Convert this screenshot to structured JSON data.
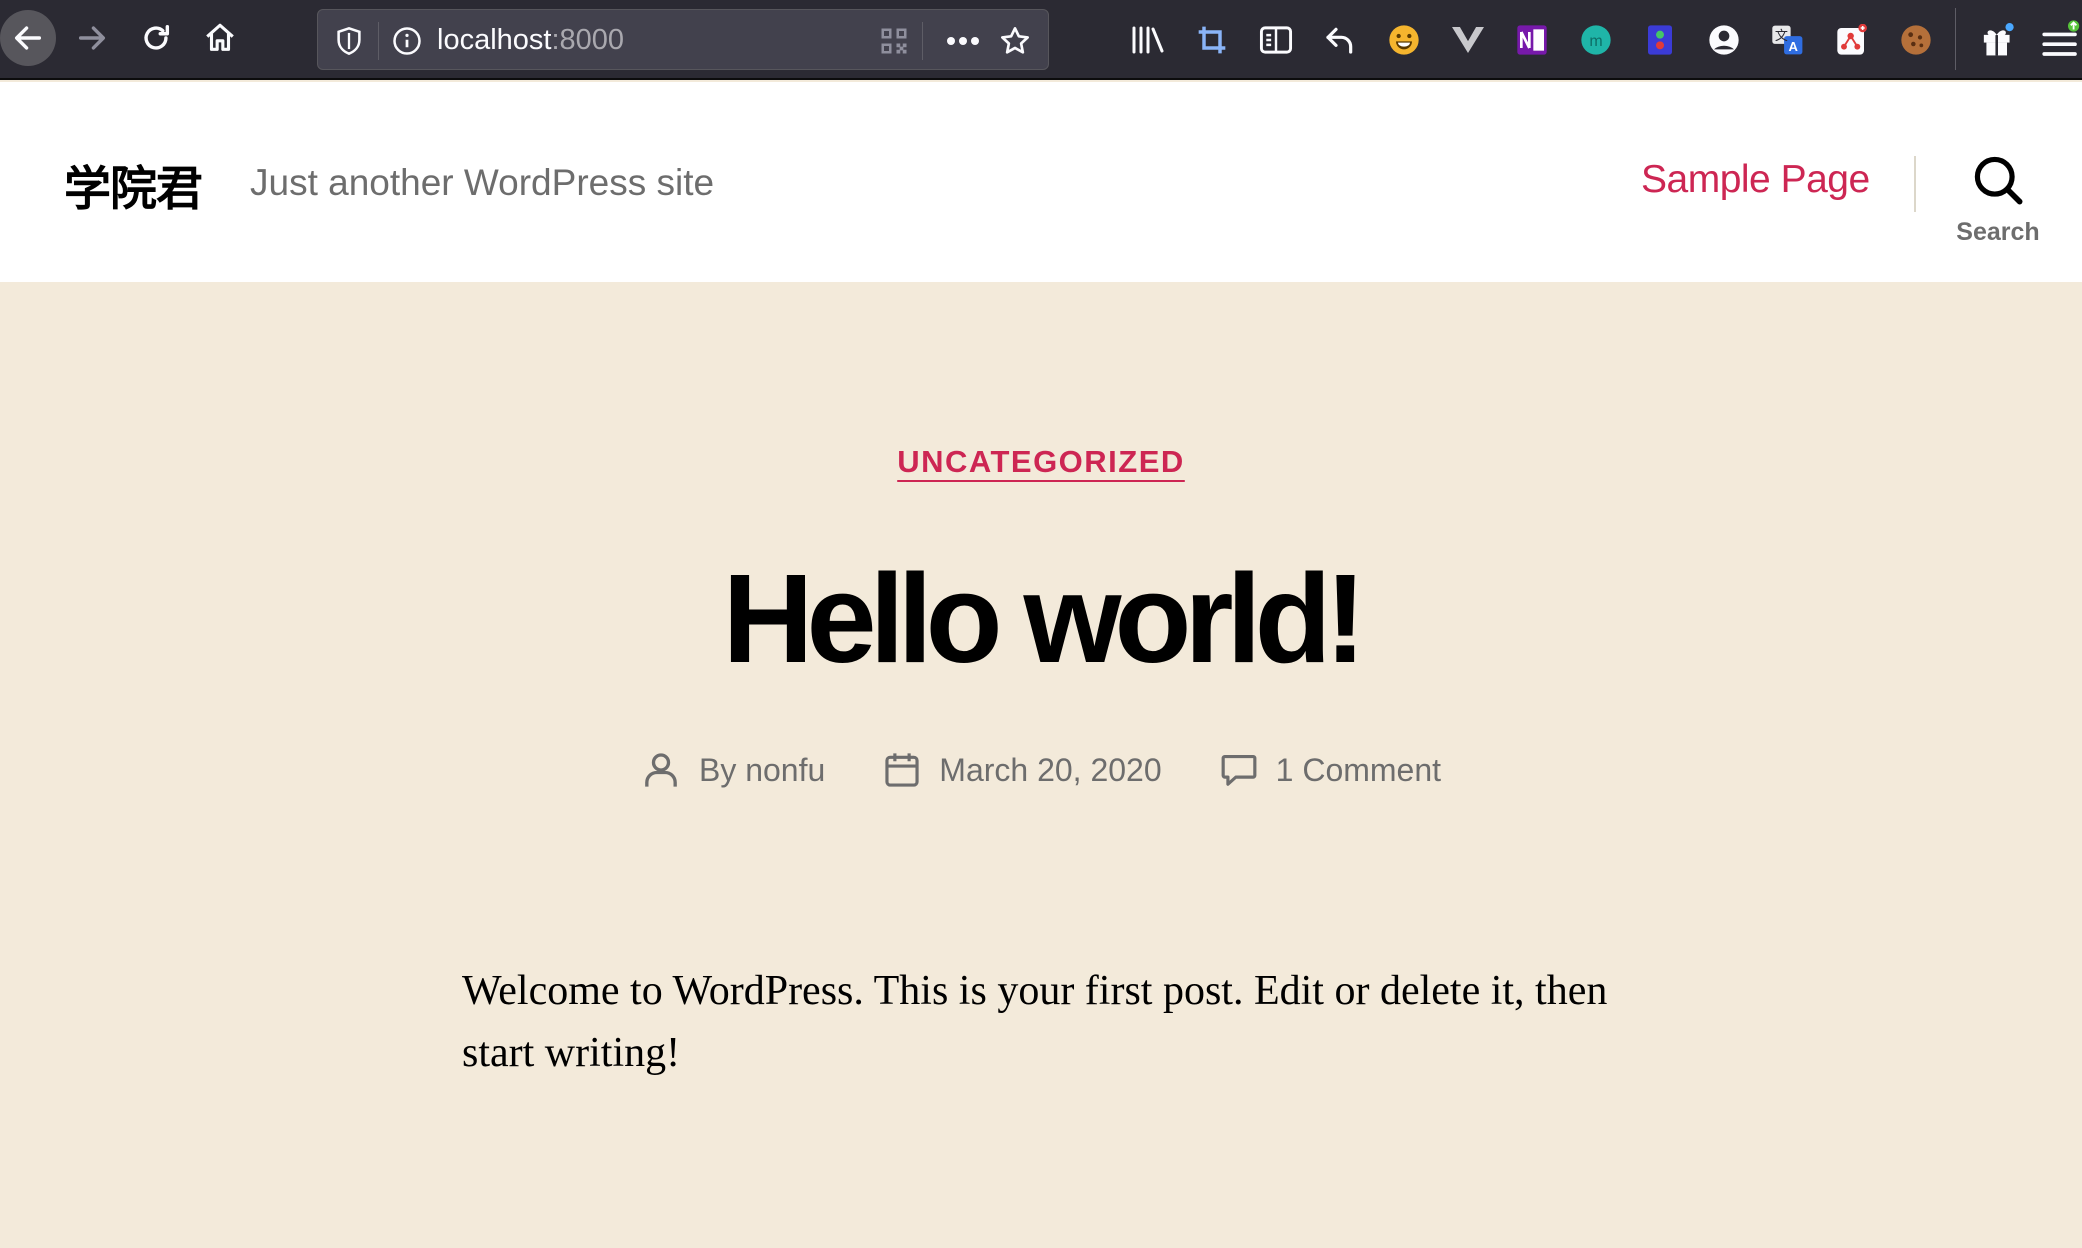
{
  "browser": {
    "url_host": "localhost",
    "url_port": ":8000",
    "icons": {
      "back": "back-arrow-icon",
      "forward": "forward-arrow-icon",
      "reload": "reload-icon",
      "home": "home-icon",
      "shield": "tracking-shield-icon",
      "info": "site-info-icon",
      "qr": "qr-code-icon",
      "more": "more-actions-icon",
      "bookmark": "bookmark-star-icon"
    },
    "extensions": [
      "library-icon",
      "crop-icon",
      "reader-view-icon",
      "undo-icon",
      "emoji-icon",
      "vue-devtools-icon",
      "onenote-icon",
      "meta-extension-icon",
      "color-picker-icon",
      "account-icon",
      "translate-icon",
      "mind-map-icon",
      "cookie-icon",
      "gift-icon",
      "menu-icon"
    ]
  },
  "site": {
    "title": "学院君",
    "description": "Just another WordPress site",
    "nav": {
      "sample_page": "Sample Page"
    },
    "search_label": "Search"
  },
  "post": {
    "category": "UNCATEGORIZED",
    "title": "Hello world!",
    "author_prefix": "By ",
    "author": "nonfu",
    "date": "March 20, 2020",
    "comments": "1 Comment",
    "body": "Welcome to WordPress. This is your first post. Edit or delete it, then start writing!"
  },
  "colors": {
    "accent": "#cd2653",
    "background": "#f3eada",
    "header_bg": "#ffffff",
    "secondary_text": "#6d6d6d",
    "toolbar_bg": "#2b2a33"
  }
}
